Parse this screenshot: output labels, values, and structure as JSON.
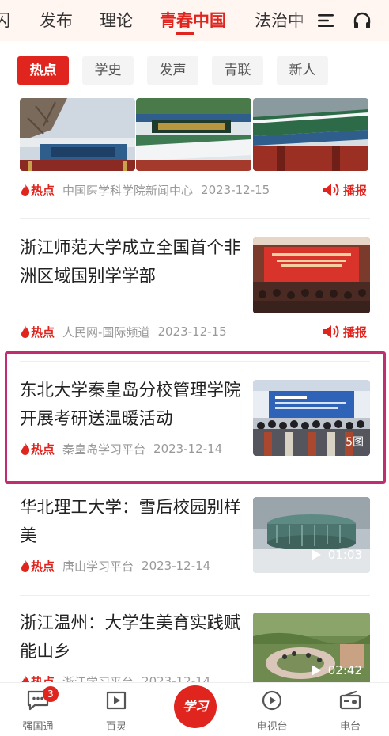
{
  "topbar": {
    "tabs": [
      {
        "label": "闪"
      },
      {
        "label": "发布"
      },
      {
        "label": "理论"
      },
      {
        "label": "青春中国"
      },
      {
        "label": "法治中"
      }
    ],
    "active_tab": "青春中国",
    "menu_icon": "hamburger-menu-icon",
    "audio_icon": "headphones-icon"
  },
  "subtabs": {
    "items": [
      {
        "label": "热点"
      },
      {
        "label": "学史"
      },
      {
        "label": "发声"
      },
      {
        "label": "青联"
      },
      {
        "label": "新人"
      }
    ],
    "active": "热点"
  },
  "feed": {
    "items": [
      {
        "tag": "热点",
        "source": "中国医学科学院新闻中心",
        "date": "2023-12-15",
        "broadcast": "播报",
        "images": [
          "campus-gate-snow",
          "campus-gate-sign",
          "campus-gate-roof"
        ]
      },
      {
        "title": "浙江师范大学成立全国首个非洲区域国别学学部",
        "tag": "热点",
        "source": "人民网-国际频道",
        "date": "2023-12-15",
        "broadcast": "播报"
      },
      {
        "title": "东北大学秦皇岛分校管理学院开展考研送温暖活动",
        "tag": "热点",
        "source": "秦皇岛学习平台",
        "date": "2023-12-14",
        "pic_count": "5图"
      },
      {
        "title": "华北理工大学：雪后校园别样美",
        "tag": "热点",
        "source": "唐山学习平台",
        "date": "2023-12-14",
        "duration": "01:03"
      },
      {
        "title": "浙江温州：大学生美育实践赋能山乡",
        "tag": "热点",
        "source": "浙江学习平台",
        "date": "2023-12-14",
        "duration": "02:42"
      }
    ]
  },
  "bottomnav": {
    "items": [
      {
        "label": "强国通",
        "badge": "3"
      },
      {
        "label": "百灵"
      },
      {
        "label": "学习"
      },
      {
        "label": "电视台"
      },
      {
        "label": "电台"
      }
    ]
  },
  "colors": {
    "accent": "#e0251f",
    "highlight_border": "#c42c72",
    "meta_gray": "#999999"
  }
}
